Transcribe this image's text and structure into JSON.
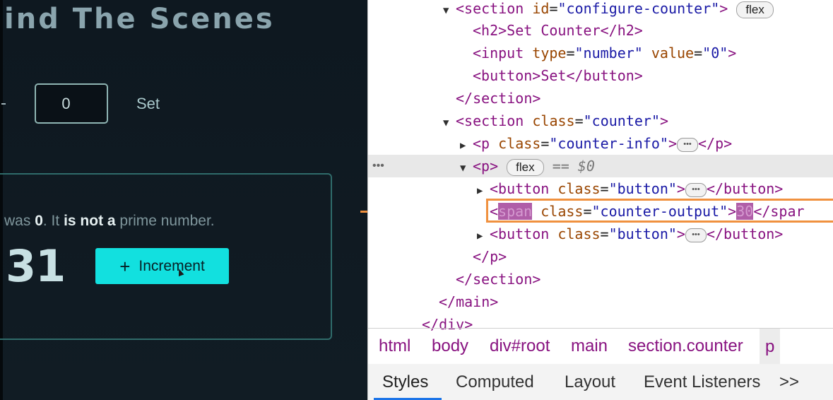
{
  "app": {
    "title": "ind The Scenes",
    "set_input_value": "0",
    "set_label": "Set",
    "info_prefix": "was ",
    "info_value": "0",
    "info_mid": ". It ",
    "info_bold": "is not a",
    "info_suffix": " prime number.",
    "count": "31",
    "increment_label": "Increment",
    "increment_icon": "+"
  },
  "devtools": {
    "dom_lines": [
      {
        "tag_open": "<section ",
        "attr": "id",
        "val": "\"configure-counter\"",
        "close": ">",
        "badge": "flex"
      },
      {
        "text": "<h2>Set Counter</h2>"
      },
      {
        "tag": "<input ",
        "attr1": "type",
        "val1": "\"number\"",
        "attr2": "value",
        "val2": "\"0\"",
        "close": ">"
      },
      {
        "text": "<button>Set</button>"
      },
      {
        "text": "</section>"
      },
      {
        "tag_open": "<section ",
        "attr": "class",
        "val": "\"counter\"",
        "close": ">"
      },
      {
        "tag_open": "<p ",
        "attr": "class",
        "val": "\"counter-info\"",
        "close": ">",
        "end": "</p>"
      },
      {
        "tag": "<p>",
        "badge": "flex",
        "ref": "== $0"
      },
      {
        "tag_open": "<button ",
        "attr": "class",
        "val": "\"button\"",
        "close": ">",
        "end": "</button>"
      },
      {
        "tag_a": "<",
        "span1": "span",
        "attr": " class",
        "val": "\"counter-output\"",
        "close": ">",
        "num": "30",
        "end": "</spar"
      },
      {
        "tag_open": "<button ",
        "attr": "class",
        "val": "\"button\"",
        "close": ">",
        "end": "</button>"
      },
      {
        "text": "</p>"
      },
      {
        "text": "</section>"
      },
      {
        "text": "</main>"
      },
      {
        "text": "</div>"
      }
    ],
    "breadcrumbs": [
      "html",
      "body",
      "div#root",
      "main",
      "section.counter",
      "p"
    ],
    "tabs": [
      "Styles",
      "Computed",
      "Layout",
      "Event Listeners"
    ],
    "more_tabs": ">>"
  }
}
